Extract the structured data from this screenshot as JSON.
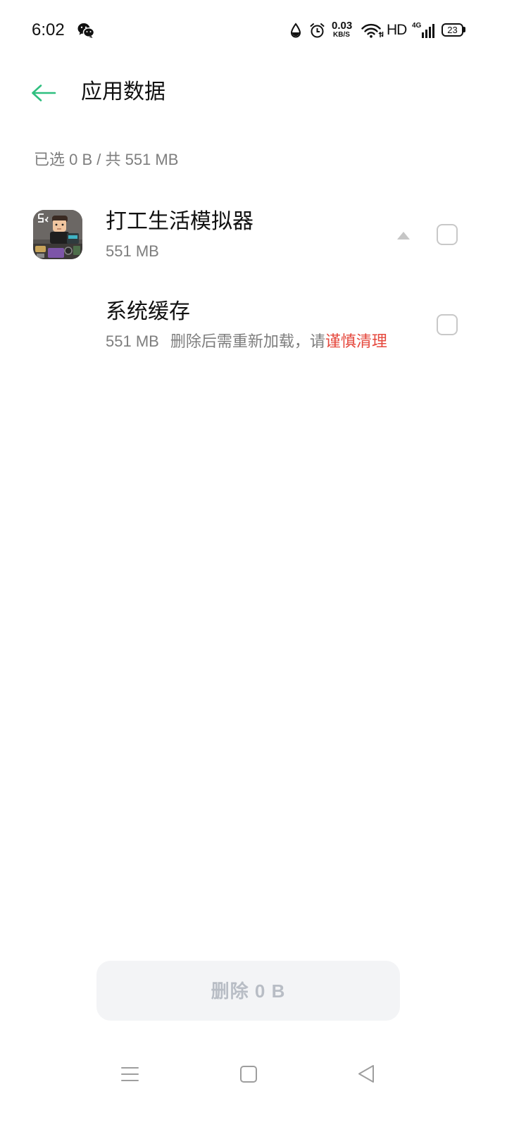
{
  "status_bar": {
    "time": "6:02",
    "speed_value": "0.03",
    "speed_unit": "KB/S",
    "hd": "HD",
    "network": "4G",
    "battery": "23"
  },
  "header": {
    "title": "应用数据"
  },
  "summary": "已选 0 B / 共 551 MB",
  "app": {
    "name": "打工生活模拟器",
    "size": "551 MB",
    "expanded": true,
    "checked": false,
    "sub_items": [
      {
        "name": "系统缓存",
        "size": "551 MB",
        "note": "删除后需重新加载，请",
        "warning": "谨慎清理",
        "checked": false
      }
    ]
  },
  "delete_button": {
    "label": "删除 0 B",
    "enabled": false
  },
  "icons": {
    "status": [
      "wechat-icon",
      "water-drop-icon",
      "alarm-icon",
      "wifi-icon",
      "signal-icon",
      "battery-icon"
    ],
    "header": "arrow-left-icon",
    "app": "game-app-icon",
    "expand": "caret-up-icon",
    "nav": [
      "menu-icon",
      "home-square-icon",
      "back-triangle-icon"
    ]
  },
  "colors": {
    "accent": "#2fbf7f",
    "warning": "#e5483d",
    "text_primary": "#1a1a1a",
    "text_secondary": "#7e7e7e",
    "button_bg": "#f3f4f6",
    "button_text": "#b8bdc5"
  }
}
